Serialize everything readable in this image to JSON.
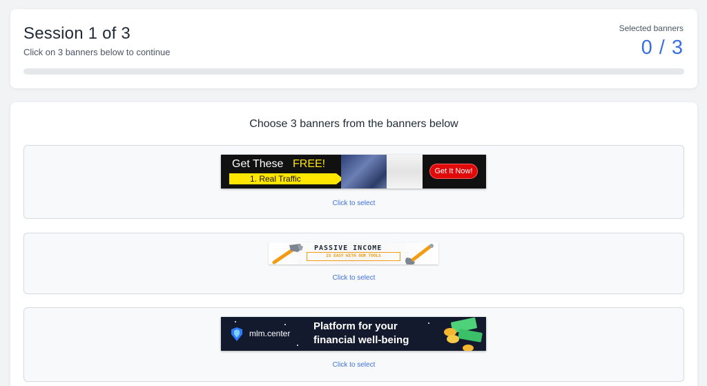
{
  "session": {
    "title": "Session 1 of 3",
    "subtitle": "Click on 3 banners below to continue",
    "selected_label": "Selected banners",
    "selected_count": "0 / 3",
    "progress_fraction": 0
  },
  "chooser": {
    "heading": "Choose 3 banners from the banners below",
    "banners": [
      {
        "click_label": "Click to select",
        "ad": {
          "line1_prefix": "Get These",
          "line1_highlight": "FREE!",
          "line2": "1. Real Traffic",
          "cta": "Get It Now!"
        }
      },
      {
        "click_label": "Click to select",
        "ad": {
          "headline": "PASSIVE INCOME",
          "subline": "IS EASY WITH OUR TOOLS"
        }
      },
      {
        "click_label": "Click to select",
        "ad": {
          "brand": "mlm.center",
          "headline_line1": "Platform for your",
          "headline_line2": "financial well-being"
        }
      }
    ]
  },
  "colors": {
    "accent": "#3b6fe0",
    "yellow": "#ffe600",
    "red_cta": "#e00a0a",
    "orange": "#f39c12",
    "dark_banner": "#141a2e"
  }
}
